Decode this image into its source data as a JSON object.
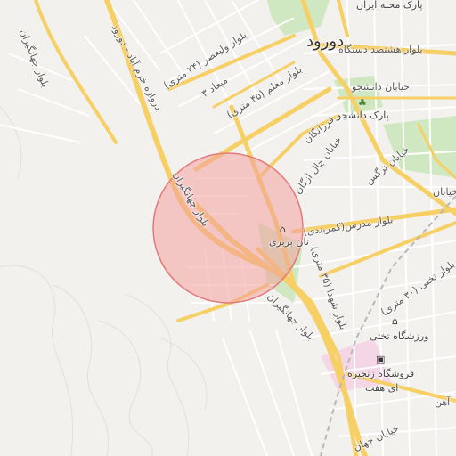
{
  "map": {
    "city": "دورود",
    "labels": {
      "top_street": "پارک محله ایران",
      "arab_street": "بلوار هشتصد دستگاه",
      "daneshjoo_street": "خیابان دانشجو",
      "daneshjoo_park": "پارک دانشجو",
      "moallem_blvd": "بلوار معلم (۴۵ متری)",
      "valiasr_blvd": "بلوار ولیعصر (۲۴ متری)",
      "meydan": "میعاد ۳",
      "farhangian": "فرزانگان",
      "chalazghan": "خیابان چال ازگان",
      "narges": "خیابان نرگس",
      "madrese_blvd": "بلوار مدرس(کمربندی)",
      "shahid_blvd": "بلوار شهدا (۳۵ متری)",
      "jahangiran_blvd_left": "بلوار جهانگیران",
      "jahangiran_blvd_bottom": "بلوار جهانگیران",
      "jahangiran_west": "بلوار جهانگیران",
      "darvazeh_khorramabad": "دروازه خرم آباد - دورود",
      "takhti_blvd": "بلوار تختی (۳۰ متری)",
      "takhti_stadium": "ورزشگاه تختی",
      "chain_store": "فروشگاه زنجیره",
      "chain_store_line2": "ای هفت",
      "barbari": "نان بربری",
      "ahan": "آهن",
      "jahan_khiaban": "خیابان جهان",
      "khiaban_partial": "خیابان"
    },
    "icons": {
      "bakery": "bread-icon",
      "park": "tree-icon",
      "stadium": "stadium-icon",
      "store": "shopping-bag-icon"
    },
    "colors": {
      "background": "#f3f1ee",
      "road_major": "#f6cf65",
      "road_minor": "#ffffff",
      "park": "#cfe8c1",
      "circle_fill": "#f2a0a0",
      "circle_stroke": "#e37a7a"
    }
  }
}
